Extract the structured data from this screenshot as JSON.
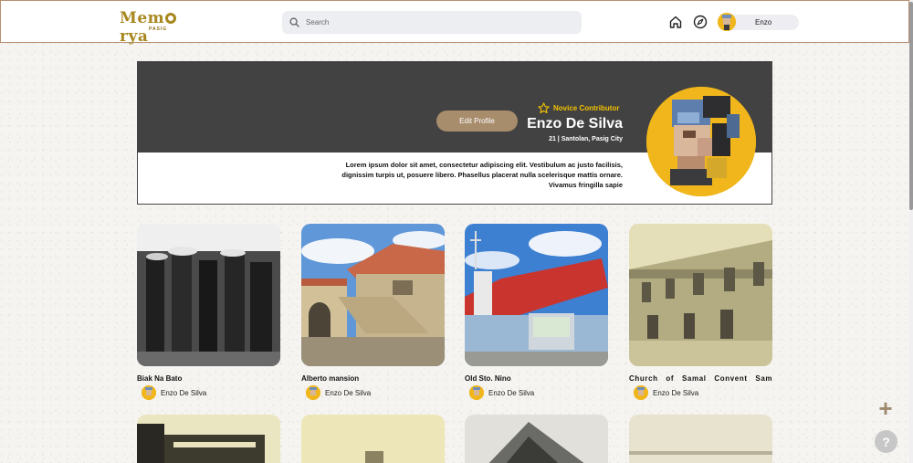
{
  "header": {
    "logo": "Mem rya",
    "logo_left": "Mem",
    "logo_right": "rya",
    "logo_sub": "PASIG",
    "search_placeholder": "Search",
    "user_name": "Enzo"
  },
  "profile": {
    "badge": "Novice Contributor",
    "name": "Enzo De Silva",
    "info": "21 | Santolan, Pasig City",
    "edit_label": "Edit Profile",
    "bio": "Lorem ipsum dolor sit amet, consectetur adipiscing elit. Vestibulum ac justo facilisis, dignissim turpis ut, posuere libero. Phasellus placerat nulla scelerisque mattis ornare. Vivamus fringilla sapie"
  },
  "posts": [
    {
      "title": "Biak Na Bato",
      "author": "Enzo De Silva"
    },
    {
      "title": "Alberto mansion",
      "author": "Enzo De Silva"
    },
    {
      "title": "Old Sto. Nino",
      "author": "Enzo De Silva"
    },
    {
      "title": "Church of Samal Convent Sam...",
      "author": "Enzo De Silva"
    }
  ],
  "colors": {
    "brand": "#a8871f",
    "banner": "#424242",
    "accent": "#f0b61c",
    "button": "#a88d6c"
  },
  "icons": {
    "search": "search-icon",
    "home": "home-icon",
    "explore": "compass-icon",
    "add": "plus-icon",
    "help": "help-icon",
    "badge": "star-icon"
  },
  "floating": {
    "add_label": "+",
    "help_label": "?"
  }
}
